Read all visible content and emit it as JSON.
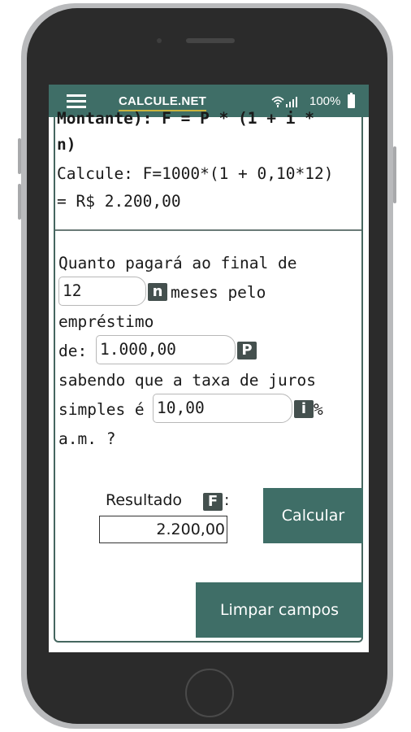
{
  "header": {
    "brand": "CALCULE.NET",
    "battery_percent": "100%",
    "icons": [
      "menu-icon",
      "wifi-icon",
      "signal-icon",
      "battery-icon"
    ]
  },
  "formula": {
    "line1": "Montante): F = P * (1 + i *",
    "line2": "n)",
    "calc_line1": "Calcule: F=1000*(1 + 0,10*12)",
    "calc_line2": "= R$ 2.200,00"
  },
  "question": {
    "line1": "Quanto pagará ao final de",
    "n_value": "12",
    "n_badge": "n",
    "after_n": "meses pelo",
    "line3": "empréstimo",
    "de_label": "de:",
    "p_value": "1.000,00",
    "p_badge": "P",
    "line5": "sabendo que a taxa de juros",
    "simples_label": "simples é",
    "i_value": "10,00",
    "i_badge": "i",
    "percent": "%",
    "line7": "a.m. ?"
  },
  "result": {
    "label": "Resultado",
    "badge": "F",
    "colon": ":",
    "value": "2.200,00"
  },
  "buttons": {
    "calculate": "Calcular",
    "clear": "Limpar campos"
  },
  "colors": {
    "primary": "#3f6e67",
    "badge": "#44504e",
    "underline": "#c9b33d"
  }
}
